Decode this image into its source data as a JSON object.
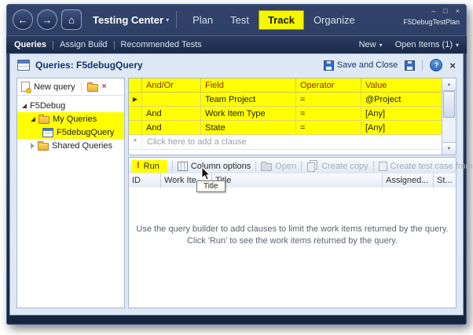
{
  "icons": {
    "back": "←",
    "forward": "→",
    "home": "⌂",
    "caret": "▾",
    "minimize": "–",
    "maximize": "□",
    "close": "×",
    "help": "?",
    "view_close": "×",
    "delete_x": "×",
    "current_row": "▶",
    "new_row": "*",
    "run": "!",
    "scroll_up": "▲",
    "scroll_down": "▼"
  },
  "chrome": {
    "center_title": "Testing Center",
    "tabs": [
      {
        "label": "Plan"
      },
      {
        "label": "Test"
      },
      {
        "label": "Track"
      },
      {
        "label": "Organize"
      }
    ],
    "plan_name": "F5DebugTestPlan"
  },
  "menubar": {
    "items": [
      {
        "label": "Queries"
      },
      {
        "label": "Assign Build"
      },
      {
        "label": "Recommended Tests"
      }
    ],
    "right": [
      {
        "label": "New"
      },
      {
        "label": "Open Items (1)"
      }
    ]
  },
  "view": {
    "title": "Queries: F5debugQuery",
    "save_and_close": "Save and Close"
  },
  "tree": {
    "new_query": "New query",
    "items": [
      {
        "label": "F5Debug"
      },
      {
        "label": "My Queries"
      },
      {
        "label": "F5debugQuery"
      },
      {
        "label": "Shared Queries"
      }
    ]
  },
  "clause_grid": {
    "columns": [
      "And/Or",
      "Field",
      "Operator",
      "Value"
    ],
    "rows": [
      {
        "andor": "",
        "field": "Team Project",
        "operator": "=",
        "value": "@Project"
      },
      {
        "andor": "And",
        "field": "Work Item Type",
        "operator": "=",
        "value": "[Any]"
      },
      {
        "andor": "And",
        "field": "State",
        "operator": "=",
        "value": "[Any]"
      }
    ],
    "add_row": "Click here to add a clause"
  },
  "results_toolbar": {
    "run": "Run",
    "column_options": "Column options",
    "open": "Open",
    "create_copy": "Create copy",
    "create_test_case": "Create test case from bug"
  },
  "results_grid": {
    "columns": [
      "ID",
      "Work Ite...",
      "Title",
      "Assigned...",
      "St..."
    ],
    "tooltip": "Title"
  },
  "empty_state": {
    "line1": "Use the query builder to add clauses to limit the work items returned by the query.",
    "line2": "Click 'Run' to see the work items returned by the query."
  }
}
